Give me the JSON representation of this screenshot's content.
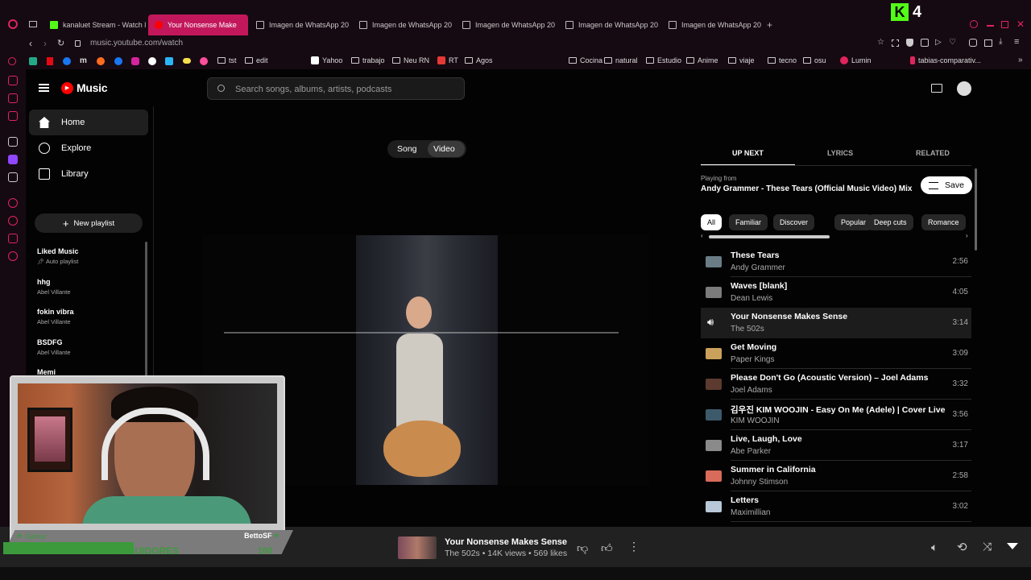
{
  "browser": {
    "tabs": [
      {
        "label": "kanaluet Stream - Watch l",
        "fav": "k"
      },
      {
        "label": "Your Nonsense Make",
        "fav": "yt",
        "active": true
      },
      {
        "label": "Imagen de WhatsApp 20",
        "fav": "doc"
      },
      {
        "label": "Imagen de WhatsApp 20",
        "fav": "doc"
      },
      {
        "label": "Imagen de WhatsApp 20",
        "fav": "doc"
      },
      {
        "label": "Imagen de WhatsApp 20",
        "fav": "doc"
      },
      {
        "label": "Imagen de WhatsApp 20",
        "fav": "doc"
      }
    ],
    "new_tab": "+",
    "url": "music.youtube.com/watch",
    "kick_counter": "4",
    "bookmarks": [
      "tst",
      "edit",
      "Yahoo",
      "trabajo",
      "Neu RN",
      "RT",
      "Agos",
      "Cocina",
      "natural",
      "Estudio",
      "Anime",
      "viaje",
      "tecno",
      "osu",
      "Lumin",
      "tabias-comparativ..."
    ],
    "bookmark_m": "m"
  },
  "ytm": {
    "logo": "Music",
    "search_placeholder": "Search songs, albums, artists, podcasts",
    "nav": [
      {
        "label": "Home",
        "icon": "home-icon"
      },
      {
        "label": "Explore",
        "icon": "compass-icon"
      },
      {
        "label": "Library",
        "icon": "library-icon"
      }
    ],
    "new_playlist": "New playlist",
    "playlists": [
      {
        "title": "Liked Music",
        "sub": "Auto playlist"
      },
      {
        "title": "hhg",
        "sub": "Abel Villante"
      },
      {
        "title": "fokin vibra",
        "sub": "Abel Villante"
      },
      {
        "title": "BSDFG",
        "sub": "Abel Villante"
      },
      {
        "title": "Memi",
        "sub": ""
      }
    ],
    "toggle": {
      "song": "Song",
      "video": "Video"
    },
    "tabs": {
      "up_next": "UP NEXT",
      "lyrics": "LYRICS",
      "related": "RELATED"
    },
    "playing_from_label": "Playing from",
    "playing_from": "Andy Grammer - These Tears (Official Music Video) Mix",
    "save": "Save",
    "chips": [
      "All",
      "Familiar",
      "Discover",
      "Popular",
      "Deep cuts",
      "Romance"
    ],
    "queue": [
      {
        "title": "These Tears",
        "artist": "Andy Grammer",
        "dur": "2:56",
        "color": "#6a7d86"
      },
      {
        "title": "Waves [blank]",
        "artist": "Dean Lewis",
        "dur": "4:05",
        "color": "#7b7b7b"
      },
      {
        "title": "Your Nonsense Makes Sense",
        "artist": "The 502s",
        "dur": "3:14",
        "color": "#1c1c1c"
      },
      {
        "title": "Get Moving",
        "artist": "Paper Kings",
        "dur": "3:09",
        "color": "#c9a15a"
      },
      {
        "title": "Please Don't Go (Acoustic Version) – Joel Adams",
        "artist": "Joel Adams",
        "dur": "3:32",
        "color": "#5c3a30"
      },
      {
        "title": "김우진 KIM WOOJIN - Easy On Me (Adele) | Cover Live",
        "artist": "KIM WOOJIN",
        "dur": "3:56",
        "color": "#3d5a6a"
      },
      {
        "title": "Live, Laugh, Love",
        "artist": "Abe Parker",
        "dur": "3:17",
        "color": "#8a8a8a"
      },
      {
        "title": "Summer in California",
        "artist": "Johnny Stimson",
        "dur": "2:58",
        "color": "#d86b5a"
      },
      {
        "title": "Letters",
        "artist": "Maximillian",
        "dur": "3:02",
        "color": "#b8c8d8"
      }
    ],
    "player": {
      "title": "Your Nonsense Makes Sense",
      "meta": "The 502s • 14K views • 569 likes"
    }
  },
  "overlay": {
    "name_left": "Gemur",
    "name_right": "BettoSF",
    "count_left": "45",
    "label": "SEGUIDORES",
    "count_right": "100",
    "progress": 0.45
  }
}
